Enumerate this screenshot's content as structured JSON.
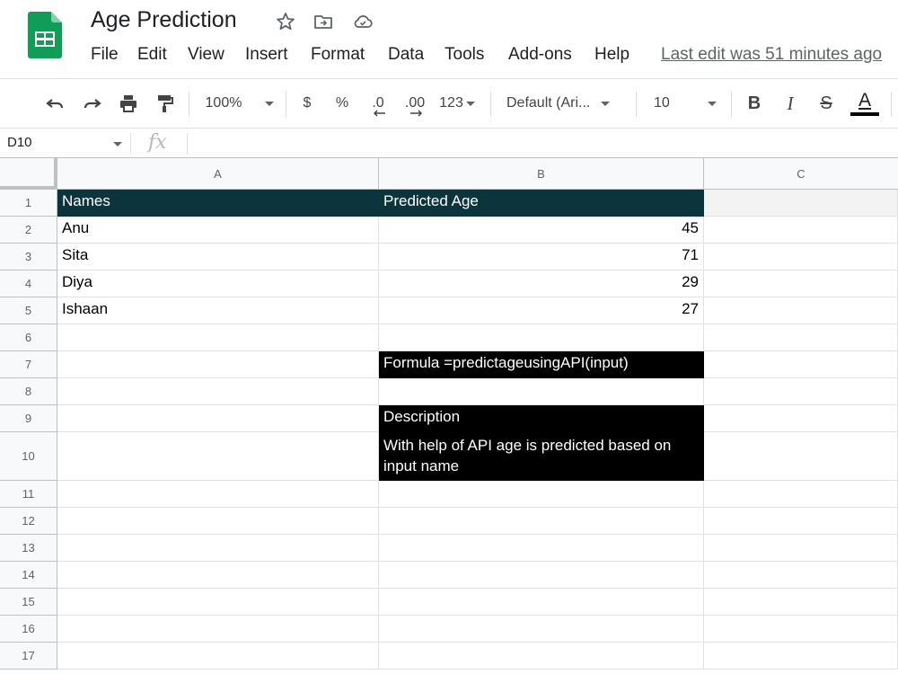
{
  "doc": {
    "title": "Age Prediction",
    "last_edit": "Last edit was 51 minutes ago"
  },
  "menu": [
    "File",
    "Edit",
    "View",
    "Insert",
    "Format",
    "Data",
    "Tools",
    "Add-ons",
    "Help"
  ],
  "toolbar": {
    "zoom": "100%",
    "currency": "$",
    "percent": "%",
    "decrease_decimal": ".0",
    "increase_decimal": ".00",
    "more_formats": "123",
    "font": "Default (Ari...",
    "font_size": "10",
    "bold": "B",
    "italic": "I",
    "strikethrough": "S",
    "text_color": "A"
  },
  "formula_bar": {
    "name_box": "D10",
    "fx": "fx",
    "content": ""
  },
  "columns": [
    "A",
    "B",
    "C"
  ],
  "rows": [
    "1",
    "2",
    "3",
    "4",
    "5",
    "6",
    "7",
    "8",
    "9",
    "10",
    "11",
    "12",
    "13",
    "14",
    "15",
    "16",
    "17"
  ],
  "cells": {
    "A1": "Names",
    "B1": "Predicted Age",
    "A2": "Anu",
    "B2": "45",
    "A3": "Sita",
    "B3": "71",
    "A4": "Diya",
    "B4": "29",
    "A5": "Ishaan",
    "B5": "27",
    "B7": "Formula  =predictageusingAPI(input)",
    "B9": "Description",
    "B10": "With help of API age is predicted based on input name"
  },
  "colors": {
    "header_fill": "#0c343d",
    "black_fill": "#000000",
    "sheets_green": "#0f9d58"
  }
}
